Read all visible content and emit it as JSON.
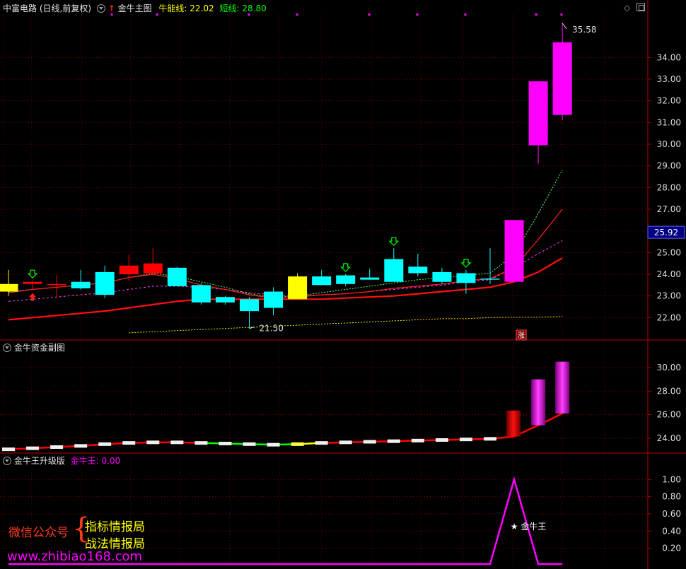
{
  "main_panel": {
    "stock_name": "中富电路",
    "period_label": "(日线,前复权)",
    "indicator_name": "金牛主图",
    "bull_line_label": "牛能线:",
    "bull_line_value": "22.02",
    "short_line_label": "短线:",
    "short_line_value": "28.80",
    "current_price_tag": "25.92",
    "high_label": "35.58",
    "low_label": "21.50",
    "rise_badge": "涨"
  },
  "fund_panel": {
    "indicator_name": "金牛资金副图"
  },
  "king_panel": {
    "indicator_name": "金牛王升级版",
    "value_label": "金牛王:",
    "value": "0.00",
    "signal_label": "金牛王"
  },
  "watermark": {
    "wechat": "微信公众号",
    "line1": "指标情报局",
    "line2": "战法情报局",
    "url": "www.zhibiao168.com"
  },
  "colors": {
    "up": "#ff0000",
    "down": "#00ffff",
    "doji": "#ffff00",
    "magenta": "#ff00ff",
    "grid": "#8b0000",
    "axis_text": "#dcdcdc",
    "green": "#00ff00"
  },
  "chart_data": [
    {
      "type": "candlestick",
      "title": "金牛主图",
      "ylim": [
        21.0,
        36.0
      ],
      "yticks": [
        22,
        23,
        24,
        25,
        26,
        27,
        28,
        29,
        30,
        31,
        32,
        33,
        34
      ],
      "candles": [
        {
          "o": 23.2,
          "h": 24.2,
          "l": 23.0,
          "c": 23.55,
          "kind": "doji"
        },
        {
          "o": 23.55,
          "h": 23.7,
          "l": 23.3,
          "c": 23.65,
          "kind": "up"
        },
        {
          "o": 23.5,
          "h": 23.95,
          "l": 22.95,
          "c": 23.55,
          "kind": "up"
        },
        {
          "o": 23.65,
          "h": 24.2,
          "l": 23.3,
          "c": 23.35,
          "kind": "down"
        },
        {
          "o": 24.1,
          "h": 24.4,
          "l": 22.9,
          "c": 23.05,
          "kind": "down"
        },
        {
          "o": 24.0,
          "h": 24.9,
          "l": 23.7,
          "c": 24.4,
          "kind": "up"
        },
        {
          "o": 24.05,
          "h": 25.2,
          "l": 23.9,
          "c": 24.5,
          "kind": "up"
        },
        {
          "o": 24.3,
          "h": 24.35,
          "l": 23.45,
          "c": 23.45,
          "kind": "down"
        },
        {
          "o": 23.5,
          "h": 23.6,
          "l": 22.6,
          "c": 22.7,
          "kind": "down"
        },
        {
          "o": 22.95,
          "h": 23.0,
          "l": 22.6,
          "c": 22.7,
          "kind": "down"
        },
        {
          "o": 22.85,
          "h": 22.95,
          "l": 21.5,
          "c": 22.3,
          "kind": "down"
        },
        {
          "o": 23.2,
          "h": 23.4,
          "l": 22.1,
          "c": 22.45,
          "kind": "down"
        },
        {
          "o": 22.85,
          "h": 24.05,
          "l": 22.85,
          "c": 23.9,
          "kind": "doji"
        },
        {
          "o": 23.9,
          "h": 24.2,
          "l": 23.5,
          "c": 23.5,
          "kind": "down"
        },
        {
          "o": 23.95,
          "h": 24.0,
          "l": 23.45,
          "c": 23.55,
          "kind": "down"
        },
        {
          "o": 23.85,
          "h": 24.25,
          "l": 23.75,
          "c": 23.75,
          "kind": "down"
        },
        {
          "o": 24.7,
          "h": 25.2,
          "l": 23.65,
          "c": 23.65,
          "kind": "down"
        },
        {
          "o": 24.35,
          "h": 24.95,
          "l": 23.9,
          "c": 24.05,
          "kind": "down"
        },
        {
          "o": 24.1,
          "h": 24.3,
          "l": 23.55,
          "c": 23.65,
          "kind": "down"
        },
        {
          "o": 24.05,
          "h": 24.2,
          "l": 23.1,
          "c": 23.6,
          "kind": "down"
        },
        {
          "o": 23.8,
          "h": 25.2,
          "l": 23.55,
          "c": 23.8,
          "kind": "down"
        },
        {
          "o": 23.65,
          "h": 26.5,
          "l": 23.65,
          "c": 26.5,
          "kind": "limit"
        },
        {
          "o": 29.95,
          "h": 32.8,
          "l": 29.1,
          "c": 32.9,
          "kind": "limit"
        },
        {
          "o": 31.35,
          "h": 35.58,
          "l": 31.1,
          "c": 34.7,
          "kind": "limit"
        }
      ],
      "series": [
        {
          "name": "牛能线",
          "values": [
            21.9,
            22.0,
            22.1,
            22.2,
            22.3,
            22.45,
            22.6,
            22.75,
            22.85,
            22.85,
            22.85,
            22.85,
            22.85,
            22.85,
            22.9,
            22.95,
            23.0,
            23.1,
            23.2,
            23.3,
            23.4,
            23.65,
            24.1,
            24.75
          ]
        },
        {
          "values": [
            23.15,
            23.3,
            23.4,
            23.5,
            23.6,
            23.85,
            24.0,
            23.8,
            23.5,
            23.3,
            23.05,
            22.9,
            22.95,
            23.05,
            23.1,
            23.2,
            23.35,
            23.45,
            23.55,
            23.7,
            23.8,
            24.3,
            25.6,
            27.0
          ]
        },
        {
          "values": [
            22.75,
            22.85,
            22.95,
            23.05,
            23.15,
            23.3,
            23.45,
            23.45,
            23.4,
            23.3,
            23.15,
            23.05,
            23.0,
            23.05,
            23.1,
            23.2,
            23.3,
            23.4,
            23.5,
            23.65,
            23.75,
            24.3,
            24.95,
            25.55
          ]
        },
        {
          "values": [
            23.2,
            23.3,
            23.4,
            23.5,
            23.6,
            23.85,
            24.05,
            23.9,
            23.65,
            23.4,
            23.1,
            22.95,
            23.0,
            23.15,
            23.3,
            23.45,
            23.6,
            23.75,
            23.85,
            23.95,
            24.05,
            24.9,
            26.8,
            28.8
          ]
        },
        {
          "values": [
            null,
            null,
            null,
            null,
            null,
            21.3,
            21.35,
            21.4,
            21.45,
            21.5,
            21.55,
            21.6,
            21.65,
            21.7,
            21.75,
            21.8,
            21.85,
            21.9,
            21.95,
            21.95,
            22.0,
            22.02,
            22.02,
            22.05
          ]
        }
      ],
      "buy_arrows_at": [
        1,
        14,
        16,
        19
      ],
      "up_arrow_at": [
        1
      ],
      "rise_badge_at": 21
    },
    {
      "type": "bar",
      "title": "金牛资金副图",
      "ylim": [
        22.8,
        31.2
      ],
      "yticks": [
        24,
        26,
        28,
        30
      ],
      "line_values": [
        23.06,
        23.15,
        23.25,
        23.35,
        23.5,
        23.6,
        23.65,
        23.65,
        23.6,
        23.55,
        23.5,
        23.45,
        23.5,
        23.6,
        23.65,
        23.7,
        23.75,
        23.8,
        23.85,
        23.9,
        23.95,
        24.15,
        25.1,
        26.1
      ],
      "bars": [
        {
          "index": 21,
          "from": 24.15,
          "to": 26.35
        },
        {
          "index": 22,
          "from": 25.1,
          "to": 29.0
        },
        {
          "index": 23,
          "from": 26.1,
          "to": 30.5
        }
      ]
    },
    {
      "type": "line",
      "title": "金牛王升级版",
      "ylim": [
        0,
        1.15
      ],
      "yticks": [
        0.2,
        0.4,
        0.6,
        0.8,
        1.0
      ],
      "values": [
        0,
        0,
        0,
        0,
        0,
        0,
        0,
        0,
        0,
        0,
        0,
        0,
        0,
        0,
        0,
        0,
        0,
        0,
        0,
        0,
        0,
        1,
        0,
        0
      ],
      "signal_at": 21
    }
  ]
}
